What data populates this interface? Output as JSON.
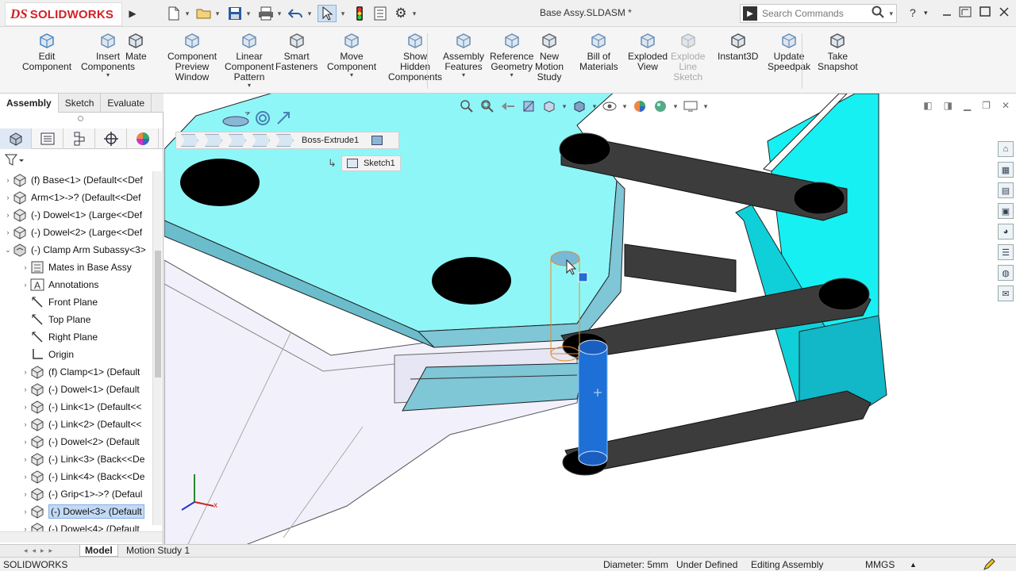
{
  "app": {
    "brand_ds": "DS",
    "brand_name": "SOLIDWORKS",
    "document_title": "Base Assy.SLDASM *"
  },
  "search": {
    "placeholder": "Search Commands"
  },
  "window_controls": {
    "help": "?"
  },
  "ribbon": {
    "buttons": [
      {
        "label": "Edit\nComponent",
        "icon": "edit-component-icon"
      },
      {
        "label": "Insert\nComponents",
        "icon": "insert-components-icon"
      },
      {
        "label": "Mate",
        "icon": "mate-icon"
      },
      {
        "label": "Component\nPreview\nWindow",
        "icon": "preview-window-icon"
      },
      {
        "label": "Linear\nComponent\nPattern",
        "icon": "linear-pattern-icon"
      },
      {
        "label": "Smart\nFasteners",
        "icon": "smart-fasteners-icon"
      },
      {
        "label": "Move\nComponent",
        "icon": "move-component-icon"
      },
      {
        "label": "Show\nHidden\nComponents",
        "icon": "show-hidden-icon"
      },
      {
        "label": "Assembly\nFeatures",
        "icon": "assembly-features-icon"
      },
      {
        "label": "Reference\nGeometry",
        "icon": "reference-geometry-icon"
      },
      {
        "label": "New\nMotion\nStudy",
        "icon": "motion-study-icon"
      },
      {
        "label": "Bill of\nMaterials",
        "icon": "bom-icon"
      },
      {
        "label": "Exploded\nView",
        "icon": "exploded-view-icon"
      },
      {
        "label": "Explode\nLine\nSketch",
        "icon": "explode-line-icon",
        "disabled": true
      },
      {
        "label": "Instant3D",
        "icon": "instant3d-icon"
      },
      {
        "label": "Update\nSpeedpak",
        "icon": "speedpak-icon"
      },
      {
        "label": "Take\nSnapshot",
        "icon": "snapshot-icon"
      }
    ]
  },
  "command_tabs": [
    {
      "label": "Assembly",
      "active": true
    },
    {
      "label": "Sketch"
    },
    {
      "label": "Evaluate"
    }
  ],
  "tree": {
    "items": [
      {
        "label": "(f) Base<1> (Default<<Def",
        "expander": "›",
        "icon": "part-icon",
        "indent": 0
      },
      {
        "label": "Arm<1>->? (Default<<Def",
        "expander": "›",
        "icon": "part-icon",
        "indent": 0
      },
      {
        "label": "(-) Dowel<1> (Large<<Def",
        "expander": "›",
        "icon": "part-icon",
        "indent": 0
      },
      {
        "label": "(-) Dowel<2> (Large<<Def",
        "expander": "›",
        "icon": "part-icon",
        "indent": 0
      },
      {
        "label": "(-) Clamp Arm Subassy<3>",
        "expander": "⌄",
        "icon": "subassembly-icon",
        "indent": 0
      },
      {
        "label": "Mates in Base Assy",
        "expander": "›",
        "icon": "mates-icon",
        "indent": 1
      },
      {
        "label": "Annotations",
        "expander": "›",
        "icon": "annotations-icon",
        "indent": 1
      },
      {
        "label": "Front Plane",
        "expander": "",
        "icon": "plane-icon",
        "indent": 1
      },
      {
        "label": "Top Plane",
        "expander": "",
        "icon": "plane-icon",
        "indent": 1
      },
      {
        "label": "Right Plane",
        "expander": "",
        "icon": "plane-icon",
        "indent": 1
      },
      {
        "label": "Origin",
        "expander": "",
        "icon": "origin-icon",
        "indent": 1
      },
      {
        "label": "(f) Clamp<1> (Default",
        "expander": "›",
        "icon": "part-icon",
        "indent": 1
      },
      {
        "label": "(-) Dowel<1> (Default",
        "expander": "›",
        "icon": "part-icon",
        "indent": 1
      },
      {
        "label": "(-) Link<1> (Default<<",
        "expander": "›",
        "icon": "part-icon",
        "indent": 1
      },
      {
        "label": "(-) Link<2> (Default<<",
        "expander": "›",
        "icon": "part-icon",
        "indent": 1
      },
      {
        "label": "(-) Dowel<2> (Default",
        "expander": "›",
        "icon": "part-icon",
        "indent": 1
      },
      {
        "label": "(-) Link<3> (Back<<De",
        "expander": "›",
        "icon": "part-icon",
        "indent": 1
      },
      {
        "label": "(-) Link<4> (Back<<De",
        "expander": "›",
        "icon": "part-icon",
        "indent": 1
      },
      {
        "label": "(-) Grip<1>->? (Defaul",
        "expander": "›",
        "icon": "part-icon",
        "indent": 1
      },
      {
        "label": "(-) Dowel<3> (Default",
        "expander": "›",
        "icon": "part-icon",
        "indent": 1,
        "selected": true
      },
      {
        "label": "(-) Dowel<4> (Default",
        "expander": "›",
        "icon": "part-icon",
        "indent": 1
      }
    ]
  },
  "viewport": {
    "breadcrumb_feature": "Boss-Extrude1",
    "breadcrumb_sketch": "Sketch1",
    "triad": {
      "x": "x"
    }
  },
  "bottom_tabs": [
    {
      "label": "Model",
      "active": true
    },
    {
      "label": "Motion Study 1"
    }
  ],
  "status": {
    "app": "SOLIDWORKS",
    "measure": "Diameter: 5mm",
    "definition": "Under Defined",
    "mode": "Editing Assembly",
    "units": "MMGS",
    "units_arrow": "▲"
  },
  "colors": {
    "accent": "#d32027",
    "selection_blue": "#1e6fd6",
    "cyan_face": "#8ff6f8"
  }
}
